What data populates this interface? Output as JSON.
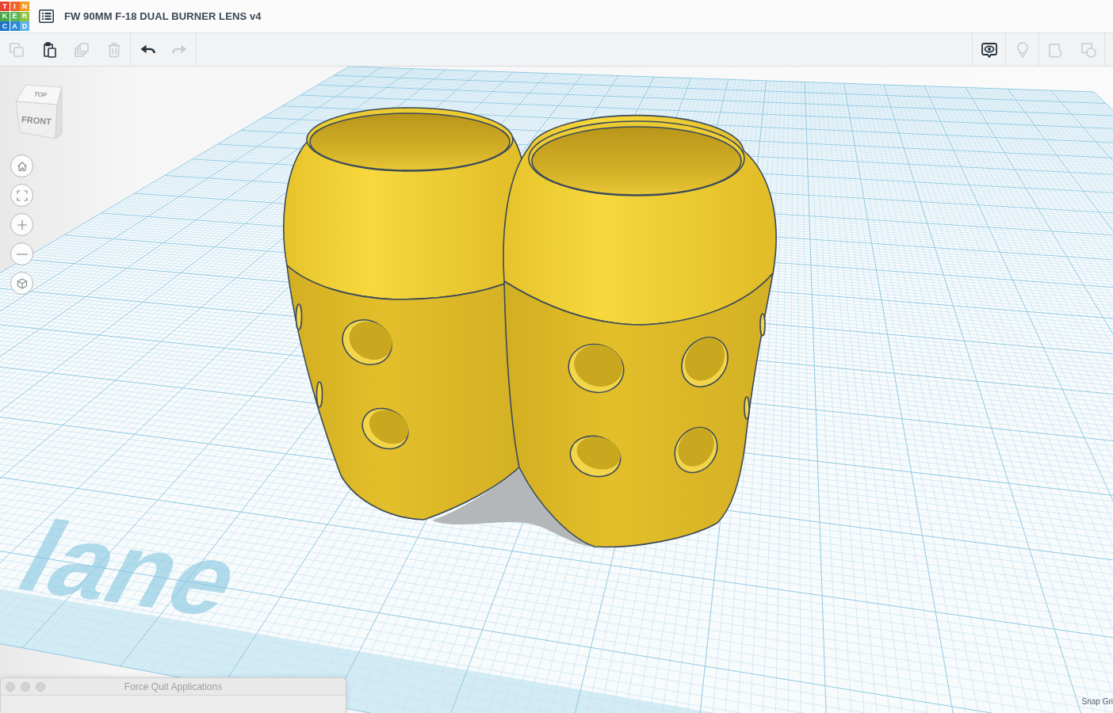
{
  "app_bar": {
    "logo": [
      {
        "letter": "T",
        "color": "#e8432e"
      },
      {
        "letter": "I",
        "color": "#f0662a"
      },
      {
        "letter": "N",
        "color": "#f59a23"
      },
      {
        "letter": "K",
        "color": "#4aa84c"
      },
      {
        "letter": "E",
        "color": "#5db55a"
      },
      {
        "letter": "R",
        "color": "#8cc342"
      },
      {
        "letter": "C",
        "color": "#1f73c4"
      },
      {
        "letter": "A",
        "color": "#2f8ad6"
      },
      {
        "letter": "D",
        "color": "#5db2e6"
      }
    ],
    "title": "FW 90MM F-18 DUAL BURNER LENS v4"
  },
  "toolbar": {
    "left_groups": [
      [
        {
          "kind": "copy",
          "disabled": true
        },
        {
          "kind": "paste",
          "disabled": false
        },
        {
          "kind": "duplicate",
          "disabled": true
        },
        {
          "kind": "delete",
          "disabled": true
        }
      ],
      [
        {
          "kind": "undo",
          "disabled": false
        },
        {
          "kind": "redo",
          "disabled": true
        }
      ]
    ],
    "right_groups": [
      [
        {
          "kind": "notes",
          "disabled": false
        }
      ],
      [
        {
          "kind": "hint",
          "disabled": true
        }
      ],
      [
        {
          "kind": "group",
          "disabled": true
        },
        {
          "kind": "ungroup",
          "disabled": true
        }
      ]
    ]
  },
  "view_cube": {
    "top": "TOP",
    "front": "FRONT"
  },
  "nav_buttons": [
    {
      "kind": "home"
    },
    {
      "kind": "fit"
    },
    {
      "kind": "zoom_in"
    },
    {
      "kind": "zoom_out"
    },
    {
      "kind": "perspective"
    }
  ],
  "workplane": {
    "label": "lane",
    "snap_grid": "Snap Gri"
  },
  "dialog": {
    "title": "Force Quit Applications"
  }
}
